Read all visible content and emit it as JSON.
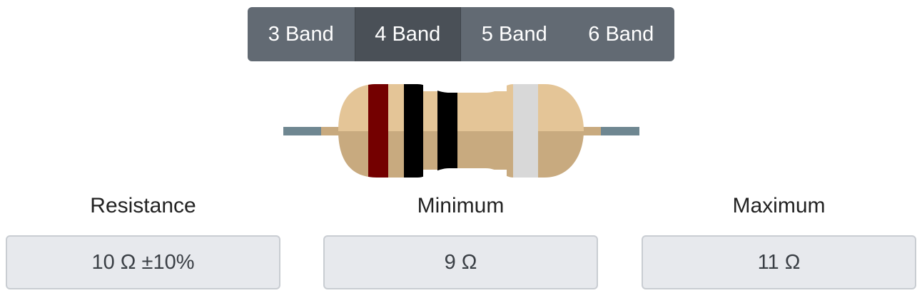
{
  "tabs": [
    {
      "label": "3 Band",
      "active": false
    },
    {
      "label": "4 Band",
      "active": true
    },
    {
      "label": "5 Band",
      "active": false
    },
    {
      "label": "6 Band",
      "active": false
    }
  ],
  "resistor": {
    "bands": [
      {
        "name": "band-1",
        "color": "#740000"
      },
      {
        "name": "band-2",
        "color": "#000000"
      },
      {
        "name": "multiplier",
        "color": "#000000"
      },
      {
        "name": "tolerance",
        "color": "#d8d8d8"
      }
    ],
    "body_color_top": "#e4c597",
    "body_color_bottom": "#c8aa7f",
    "lead_color": "#6f8791"
  },
  "results": {
    "resistance": {
      "label": "Resistance",
      "value": "10 Ω ±10%"
    },
    "minimum": {
      "label": "Minimum",
      "value": "9 Ω"
    },
    "maximum": {
      "label": "Maximum",
      "value": "11 Ω"
    }
  }
}
